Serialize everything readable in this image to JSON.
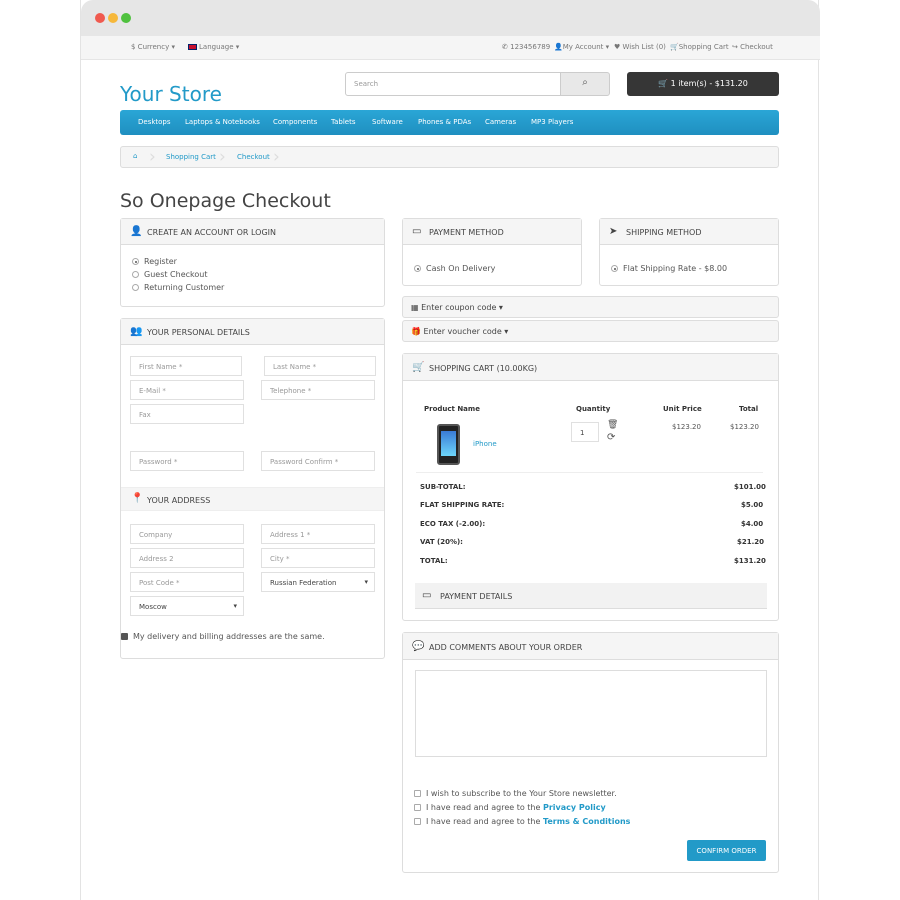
{
  "topbar": {
    "currency": "$ Currency",
    "language": "Language",
    "phone": "123456789",
    "my_account": "My Account",
    "wish_list": "Wish List (0)",
    "shopping_cart": "Shopping Cart",
    "checkout": "Checkout"
  },
  "header": {
    "logo": "Your Store",
    "search_placeholder": "Search",
    "cart_button": "1 item(s) - $131.20"
  },
  "nav": {
    "items": [
      "Desktops",
      "Laptops & Notebooks",
      "Components",
      "Tablets",
      "Software",
      "Phones & PDAs",
      "Cameras",
      "MP3 Players"
    ]
  },
  "breadcrumb": {
    "items": [
      "Shopping Cart",
      "Checkout"
    ]
  },
  "page_title": "So Onepage Checkout",
  "account": {
    "title": "CREATE AN ACCOUNT OR LOGIN",
    "options": [
      "Register",
      "Guest Checkout",
      "Returning Customer"
    ],
    "selected": "Register"
  },
  "personal": {
    "title": "YOUR PERSONAL DETAILS",
    "first_name": "First Name *",
    "last_name": "Last Name *",
    "email": "E-Mail *",
    "telephone": "Telephone *",
    "fax": "Fax",
    "password": "Password *",
    "password_confirm": "Password Confirm *"
  },
  "address": {
    "title": "YOUR ADDRESS",
    "company": "Company",
    "address1": "Address 1 *",
    "address2": "Address 2",
    "city": "City *",
    "post_code": "Post Code *",
    "country": "Russian Federation",
    "region": "Moscow",
    "same_address": "My delivery and billing addresses are the same."
  },
  "payment_method": {
    "title": "PAYMENT METHOD",
    "option": "Cash On Delivery"
  },
  "shipping_method": {
    "title": "SHIPPING METHOD",
    "option": "Flat Shipping Rate - $8.00"
  },
  "coupon": "Enter coupon code",
  "voucher": "Enter voucher code",
  "cart": {
    "title": "SHOPPING CART (10.00KG)",
    "headers": [
      "Product Name",
      "Quantity",
      "Unit Price",
      "Total"
    ],
    "product": {
      "name": "iPhone",
      "qty": "1",
      "unit_price": "$123.20",
      "total": "$123.20"
    },
    "totals": [
      {
        "label": "SUB-TOTAL:",
        "value": "$101.00"
      },
      {
        "label": "FLAT SHIPPING RATE:",
        "value": "$5.00"
      },
      {
        "label": "ECO TAX (-2.00):",
        "value": "$4.00"
      },
      {
        "label": "VAT (20%):",
        "value": "$21.20"
      },
      {
        "label": "TOTAL:",
        "value": "$131.20"
      }
    ],
    "payment_details": "PAYMENT DETAILS"
  },
  "comments": {
    "title": "ADD COMMENTS ABOUT YOUR ORDER",
    "newsletter": "I wish to subscribe to the Your Store newsletter.",
    "agree_prefix": "I have read and agree to the",
    "privacy": "Privacy Policy",
    "terms": "Terms & Conditions",
    "confirm": "CONFIRM ORDER"
  },
  "colors": {
    "accent": "#229ac8",
    "dark": "#363636"
  }
}
